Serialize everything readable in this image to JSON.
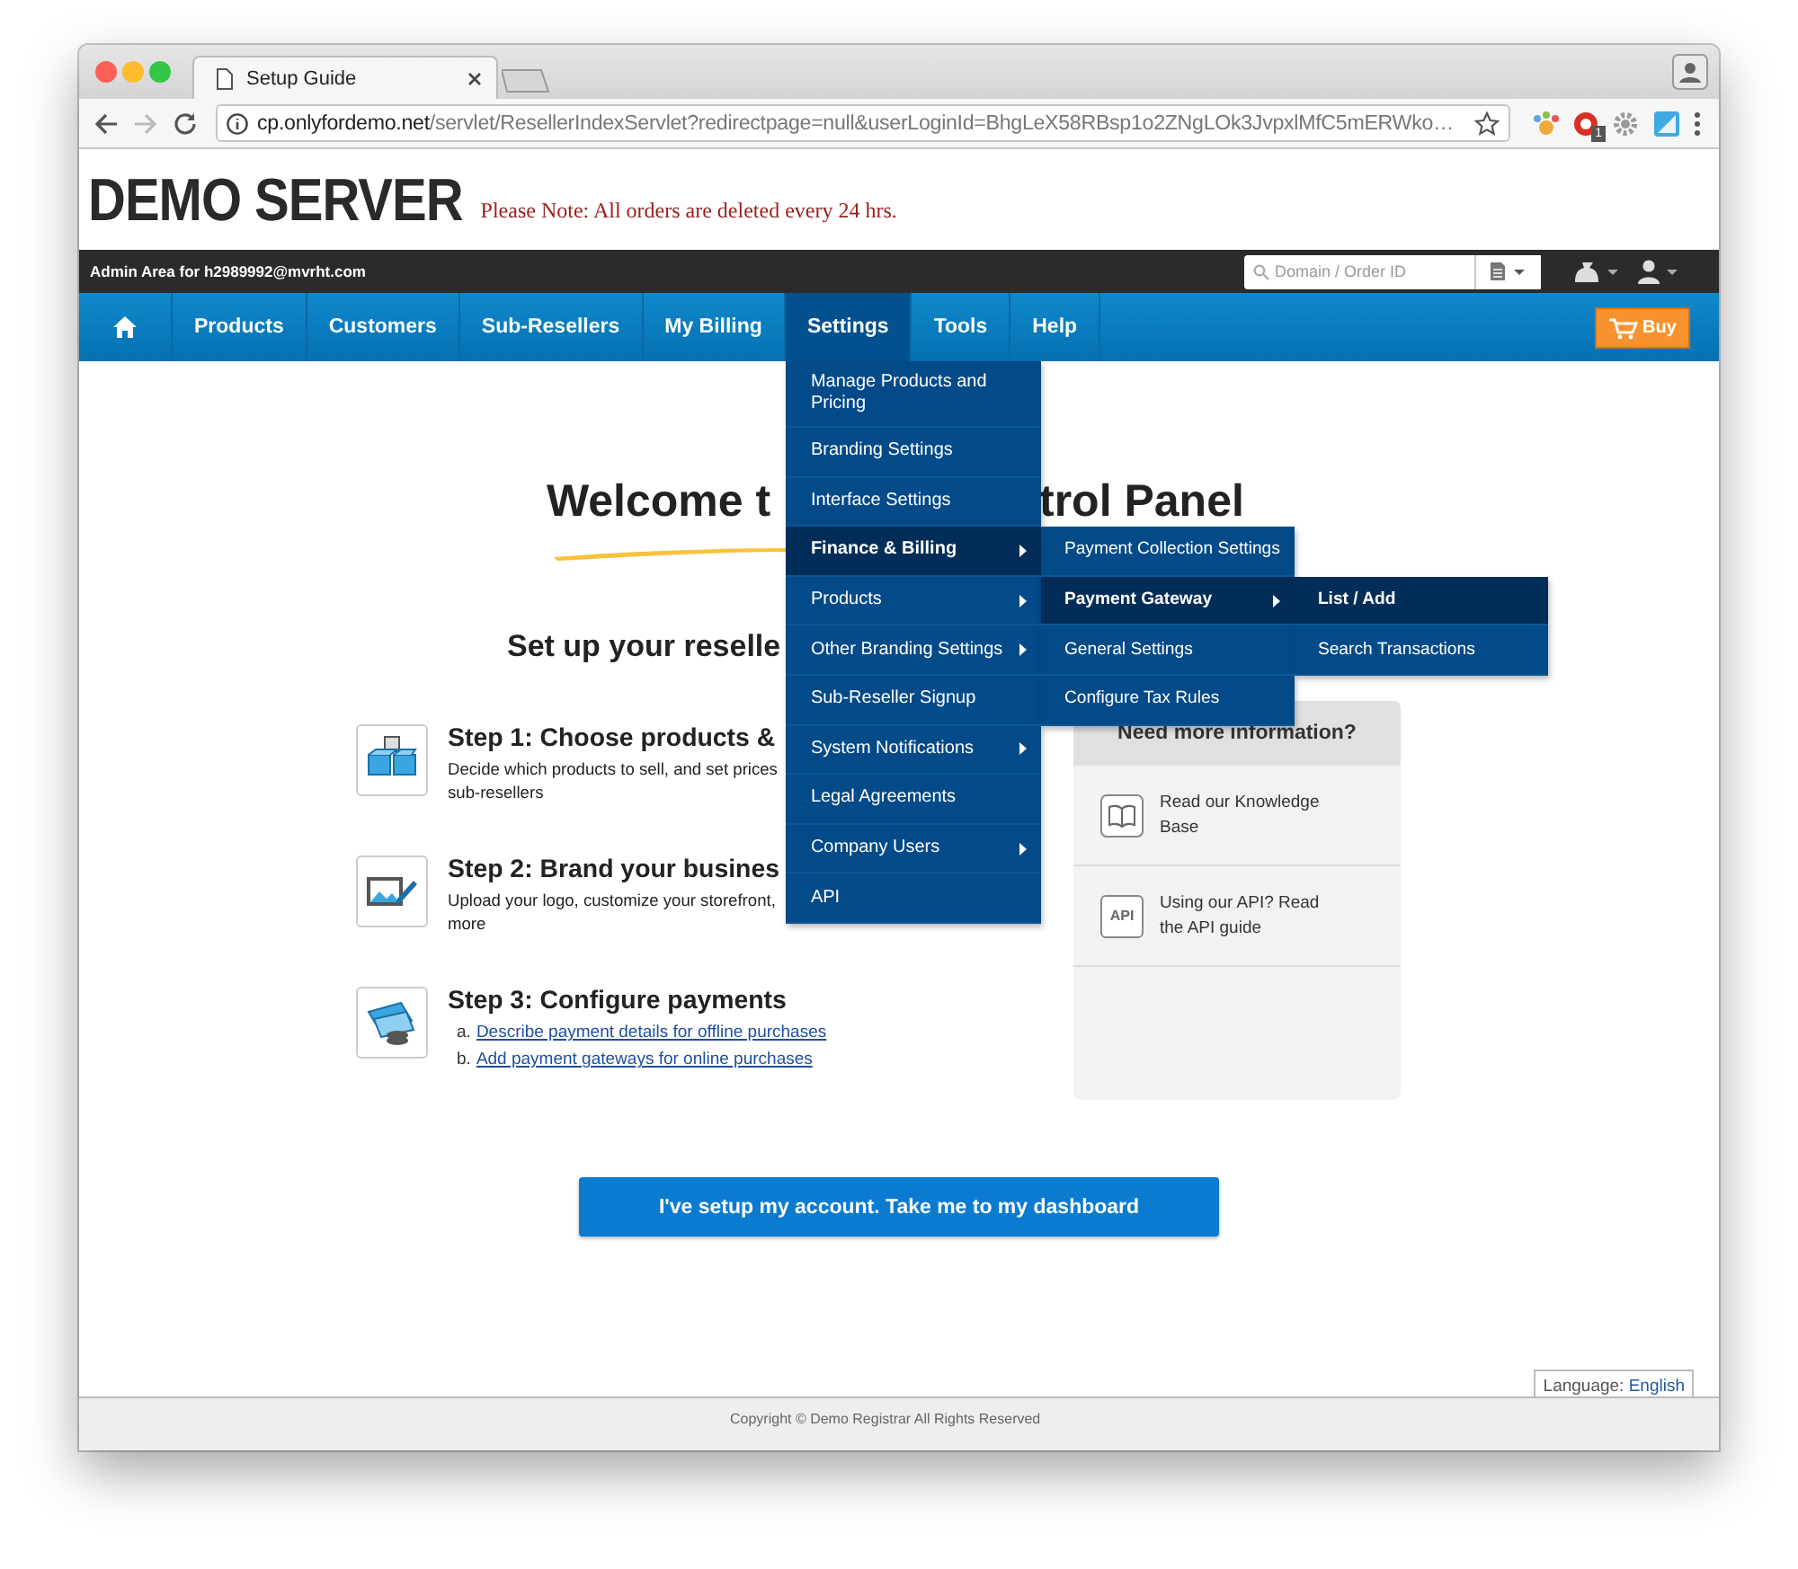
{
  "browser": {
    "tab_title": "Setup Guide",
    "url_host": "cp.onlyfordemo.net",
    "url_path": "/servlet/ResellerIndexServlet?redirectpage=null&userLoginId=BhgLeX58RBsp1o2ZNgLOk3JvpxlMfC5mERWko…",
    "extension_badge": "1"
  },
  "header": {
    "logo": "DEMO SERVER",
    "note": "Please Note: All orders are deleted every 24 hrs."
  },
  "admin_bar": {
    "label": "Admin Area for h2989992@mvrht.com",
    "search_placeholder": "Domain / Order ID"
  },
  "nav": [
    {
      "kind": "home",
      "selected": false
    },
    {
      "kind": "text",
      "label": "Products",
      "selected": false
    },
    {
      "kind": "text",
      "label": "Customers",
      "selected": false
    },
    {
      "kind": "text",
      "label": "Sub-Resellers",
      "selected": false
    },
    {
      "kind": "text",
      "label": "My Billing",
      "selected": false
    },
    {
      "kind": "text",
      "label": "Settings",
      "selected": true
    },
    {
      "kind": "text",
      "label": "Tools",
      "selected": false
    },
    {
      "kind": "text",
      "label": "Help",
      "selected": false
    }
  ],
  "buy_button": "Buy",
  "settings_menu": [
    {
      "label": "Manage Products and Pricing",
      "has_submenu": false,
      "selected": false
    },
    {
      "label": "Branding Settings",
      "has_submenu": false,
      "selected": false
    },
    {
      "label": "Interface Settings",
      "has_submenu": false,
      "selected": false
    },
    {
      "label": "Finance & Billing",
      "has_submenu": true,
      "selected": true,
      "children": [
        {
          "label": "Payment Collection Settings",
          "has_submenu": false,
          "selected": false
        },
        {
          "label": "Payment Gateway",
          "has_submenu": true,
          "selected": true,
          "children": [
            {
              "label": "List / Add",
              "has_submenu": false,
              "selected": true
            },
            {
              "label": "Search Transactions",
              "has_submenu": false,
              "selected": false
            }
          ]
        },
        {
          "label": "General Settings",
          "has_submenu": false,
          "selected": false
        },
        {
          "label": "Configure Tax Rules",
          "has_submenu": false,
          "selected": false
        }
      ]
    },
    {
      "label": "Products",
      "has_submenu": true,
      "selected": false
    },
    {
      "label": "Other Branding Settings",
      "has_submenu": true,
      "selected": false
    },
    {
      "label": "Sub-Reseller Signup",
      "has_submenu": false,
      "selected": false
    },
    {
      "label": "System Notifications",
      "has_submenu": true,
      "selected": false
    },
    {
      "label": "Legal Agreements",
      "has_submenu": false,
      "selected": false
    },
    {
      "label": "Company Users",
      "has_submenu": true,
      "selected": false
    },
    {
      "label": "API",
      "has_submenu": false,
      "selected": false
    }
  ],
  "welcome": {
    "heading_parts": [
      "Welcome t",
      "trol Panel"
    ],
    "subheading": "Set up your reselle"
  },
  "steps": [
    {
      "kind": "products",
      "title": "Step 1: Choose products &",
      "lines": [
        "Decide which products to sell, and set prices",
        "sub-resellers"
      ]
    },
    {
      "kind": "brand",
      "title": "Step 2: Brand your busines",
      "lines": [
        "Upload your logo, customize your storefront,",
        "more"
      ]
    },
    {
      "kind": "payments",
      "title": "Step 3: Configure payments",
      "links": [
        {
          "marker": "a.",
          "text": "Describe payment details for offline purchases"
        },
        {
          "marker": "b.",
          "text": "Add payment gateways for online purchases"
        }
      ]
    }
  ],
  "info_panel": {
    "title": "Need more information?",
    "items": [
      {
        "kind": "book",
        "text": "Read our Knowledge Base"
      },
      {
        "kind": "api",
        "icon_label": "API",
        "text": "Using our API? Read the API guide"
      }
    ]
  },
  "dashboard_button": "I've setup my account. Take me to my dashboard",
  "language": {
    "label": "Language:",
    "value": "English"
  },
  "footer": "Copyright © Demo Registrar All Rights Reserved"
}
